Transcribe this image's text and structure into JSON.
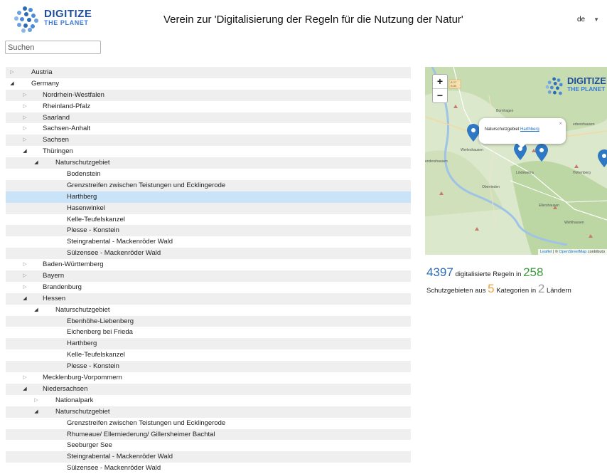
{
  "header": {
    "logo_title": "DIGITIZE",
    "logo_subtitle": "THE PLANET",
    "title": "Verein zur 'Digitalisierung der Regeln für die Nutzung der Natur'",
    "language": "de"
  },
  "search": {
    "placeholder": "Suchen"
  },
  "tree": [
    {
      "label": "Austria",
      "level": 0,
      "state": "closed"
    },
    {
      "label": "Germany",
      "level": 0,
      "state": "open"
    },
    {
      "label": "Nordrhein-Westfalen",
      "level": 1,
      "state": "closed"
    },
    {
      "label": "Rheinland-Pfalz",
      "level": 1,
      "state": "closed"
    },
    {
      "label": "Saarland",
      "level": 1,
      "state": "closed"
    },
    {
      "label": "Sachsen-Anhalt",
      "level": 1,
      "state": "closed"
    },
    {
      "label": "Sachsen",
      "level": 1,
      "state": "closed"
    },
    {
      "label": "Thüringen",
      "level": 1,
      "state": "open"
    },
    {
      "label": "Naturschutzgebiet",
      "level": 2,
      "state": "open"
    },
    {
      "label": "Bodenstein",
      "level": 3,
      "state": "leaf"
    },
    {
      "label": "Grenzstreifen zwischen Teistungen und Ecklingerode",
      "level": 3,
      "state": "leaf"
    },
    {
      "label": "Harthberg",
      "level": 3,
      "state": "leaf",
      "selected": true
    },
    {
      "label": "Hasenwinkel",
      "level": 3,
      "state": "leaf"
    },
    {
      "label": "Kelle-Teufelskanzel",
      "level": 3,
      "state": "leaf"
    },
    {
      "label": "Plesse - Konstein",
      "level": 3,
      "state": "leaf"
    },
    {
      "label": "Steingrabental - Mackenröder Wald",
      "level": 3,
      "state": "leaf"
    },
    {
      "label": "Sülzensee - Mackenröder Wald",
      "level": 3,
      "state": "leaf"
    },
    {
      "label": "Baden-Württemberg",
      "level": 1,
      "state": "closed"
    },
    {
      "label": "Bayern",
      "level": 1,
      "state": "closed"
    },
    {
      "label": "Brandenburg",
      "level": 1,
      "state": "closed"
    },
    {
      "label": "Hessen",
      "level": 1,
      "state": "open"
    },
    {
      "label": "Naturschutzgebiet",
      "level": 2,
      "state": "open"
    },
    {
      "label": "Ebenhöhe-Liebenberg",
      "level": 3,
      "state": "leaf"
    },
    {
      "label": "Eichenberg bei Frieda",
      "level": 3,
      "state": "leaf"
    },
    {
      "label": "Harthberg",
      "level": 3,
      "state": "leaf"
    },
    {
      "label": "Kelle-Teufelskanzel",
      "level": 3,
      "state": "leaf"
    },
    {
      "label": "Plesse - Konstein",
      "level": 3,
      "state": "leaf"
    },
    {
      "label": "Mecklenburg-Vorpommern",
      "level": 1,
      "state": "closed"
    },
    {
      "label": "Niedersachsen",
      "level": 1,
      "state": "open"
    },
    {
      "label": "Nationalpark",
      "level": 2,
      "state": "closed"
    },
    {
      "label": "Naturschutzgebiet",
      "level": 2,
      "state": "open"
    },
    {
      "label": "Grenzstreifen zwischen Teistungen und Ecklingerode",
      "level": 3,
      "state": "leaf"
    },
    {
      "label": "Rhumeaue/ Ellerniederung/ Gillersheimer Bachtal",
      "level": 3,
      "state": "leaf"
    },
    {
      "label": "Seeburger See",
      "level": 3,
      "state": "leaf"
    },
    {
      "label": "Steingrabental - Mackenröder Wald",
      "level": 3,
      "state": "leaf"
    },
    {
      "label": "Sülzensee - Mackenröder Wald",
      "level": 3,
      "state": "leaf"
    }
  ],
  "map": {
    "zoom_in": "+",
    "zoom_out": "−",
    "popup_prefix": "Naturschutzgebiet",
    "popup_link": "Harthberg",
    "popup_close": "×",
    "logo_title": "DIGITIZE",
    "logo_subtitle": "THE PLANET",
    "attribution_leaflet": "Leaflet",
    "attribution_sep": "| ©",
    "attribution_osm": "OpenStreetMap",
    "attribution_tail": "contributo",
    "place_labels": [
      "Bornhagen",
      "Werleshausen",
      "Lindewerra",
      "Oberrieden",
      "Ellershausen",
      "Wahlhausen",
      "Hohenberg",
      "erbershausen",
      "endershausen"
    ],
    "road_label": "B 27\nB 80",
    "marker_color": "#2f78c4"
  },
  "stats": {
    "rules_count": "4397",
    "rules_text": "digitalisierte Regeln in",
    "areas_count": "258",
    "areas_text": "Schutzgebieten aus",
    "categories_count": "5",
    "categories_text": "Kategorien in",
    "countries_count": "2",
    "countries_text": "Ländern"
  },
  "colors": {
    "selected_row": "#c9e4f8",
    "stripe": "#efefef",
    "rules_color": "#2a6bb3",
    "areas_color": "#3c9a3c",
    "categories_color": "#f0a33a",
    "countries_color": "#9a9a9a"
  }
}
